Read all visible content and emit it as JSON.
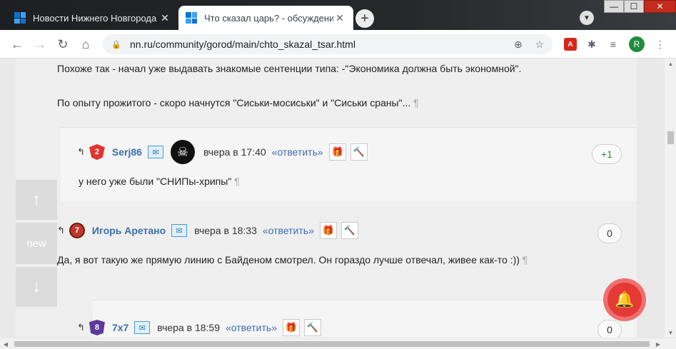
{
  "browser": {
    "tabs": [
      {
        "title": "Новости Нижнего Новгорода | Н",
        "active": false
      },
      {
        "title": "Что сказал царь? - обсуждение",
        "active": true
      }
    ],
    "new_tab_label": "+",
    "close_glyph": "✕",
    "url": "nn.ru/community/gorod/main/chto_skazal_tsar.html",
    "profile_initial": "R",
    "window_controls": {
      "minimize": "—",
      "maximize": "☐",
      "close": "✕"
    }
  },
  "icons": {
    "back": "←",
    "forward": "→",
    "reload": "↻",
    "home": "⌂",
    "lock": "🔒",
    "zoom": "⊕",
    "star": "☆",
    "pdf": "A",
    "puzzle": "✱",
    "media": "≡"
  },
  "post": {
    "lines": [
      "Похоже так - начал уже выдавать знакомые сентенции типа: -\"Экономика должна быть экономной\".",
      "По опыту прожитого - скоро начнутся \"Сиськи-мосиськи\" и \"Сиськи сраны\"..."
    ]
  },
  "pilcrow": "¶",
  "comments": [
    {
      "badge": "2",
      "author": "Serj86",
      "time": "вчера в 17:40",
      "reply": "«ответить»",
      "text": "у него уже были \"СНИПы-хрипы\"",
      "vote": "+1"
    },
    {
      "badge": "7",
      "author": "Игорь Аретано",
      "time": "вчера в 18:33",
      "reply": "«ответить»",
      "text": "Да, я вот такую же прямую линию с Байденом смотрел. Он гораздо лучше отвечал, живее как-то :))",
      "vote": "0"
    },
    {
      "badge": "8",
      "author": "7x7",
      "time": "вчера в 18:59",
      "reply": "«ответить»",
      "vote": "0"
    }
  ],
  "side_nav": {
    "up": "↑",
    "new": "new",
    "down": "↓"
  },
  "colors": {
    "link": "#3b6fb0",
    "bell": "#e53935",
    "positive_vote": "#3a8f3a"
  }
}
